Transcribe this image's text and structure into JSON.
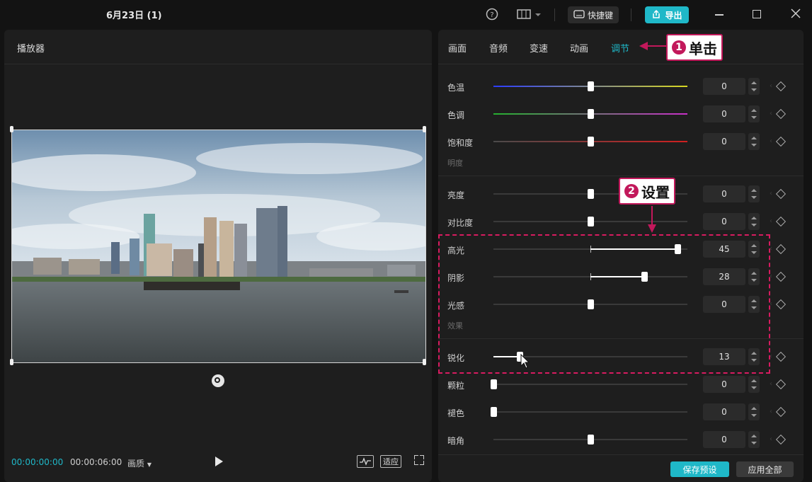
{
  "window": {
    "title": "6月23日 (1)",
    "shortcut_label": "快捷键",
    "export_label": "导出"
  },
  "player": {
    "title": "播放器",
    "time_current": "00:00:00:00",
    "time_total": "00:00:06:00",
    "quality_label": "画质",
    "fit_label": "适应"
  },
  "adjust": {
    "tabs": [
      "画面",
      "音频",
      "变速",
      "动画",
      "调节"
    ],
    "active_tab": "调节",
    "sections": {
      "brightness": "明度",
      "effects": "效果"
    },
    "rows": [
      {
        "label": "色温",
        "value": "0"
      },
      {
        "label": "色调",
        "value": "0"
      },
      {
        "label": "饱和度",
        "value": "0"
      },
      {
        "label": "亮度",
        "value": "0"
      },
      {
        "label": "对比度",
        "value": "0"
      },
      {
        "label": "高光",
        "value": "45"
      },
      {
        "label": "阴影",
        "value": "28"
      },
      {
        "label": "光感",
        "value": "0"
      },
      {
        "label": "锐化",
        "value": "13"
      },
      {
        "label": "颗粒",
        "value": "0"
      },
      {
        "label": "褪色",
        "value": "0"
      },
      {
        "label": "暗角",
        "value": "0"
      }
    ],
    "save_preset_label": "保存预设",
    "apply_all_label": "应用全部"
  },
  "annotations": {
    "step1": {
      "num": "1",
      "text": "单击"
    },
    "step2": {
      "num": "2",
      "text": "设置"
    }
  },
  "colors": {
    "accent": "#1fb8c8",
    "annotation": "#c2185b"
  }
}
